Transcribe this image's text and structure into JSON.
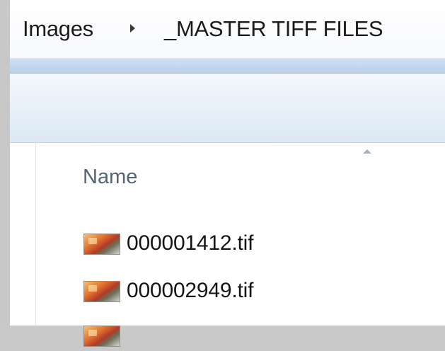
{
  "breadcrumb": {
    "items": [
      "Images",
      "_MASTER TIFF FILES"
    ]
  },
  "columns": {
    "name": "Name"
  },
  "files": [
    {
      "name": "000001412.tif",
      "icon": "tiff-image-icon"
    },
    {
      "name": "000002949.tif",
      "icon": "tiff-image-icon"
    },
    {
      "name": "",
      "icon": "tiff-image-icon"
    }
  ],
  "colors": {
    "frame": "#c9c9c9",
    "address_bar": "#ffffff",
    "toolbar_band": "#b8d0ea",
    "column_header_text": "#54637a"
  }
}
